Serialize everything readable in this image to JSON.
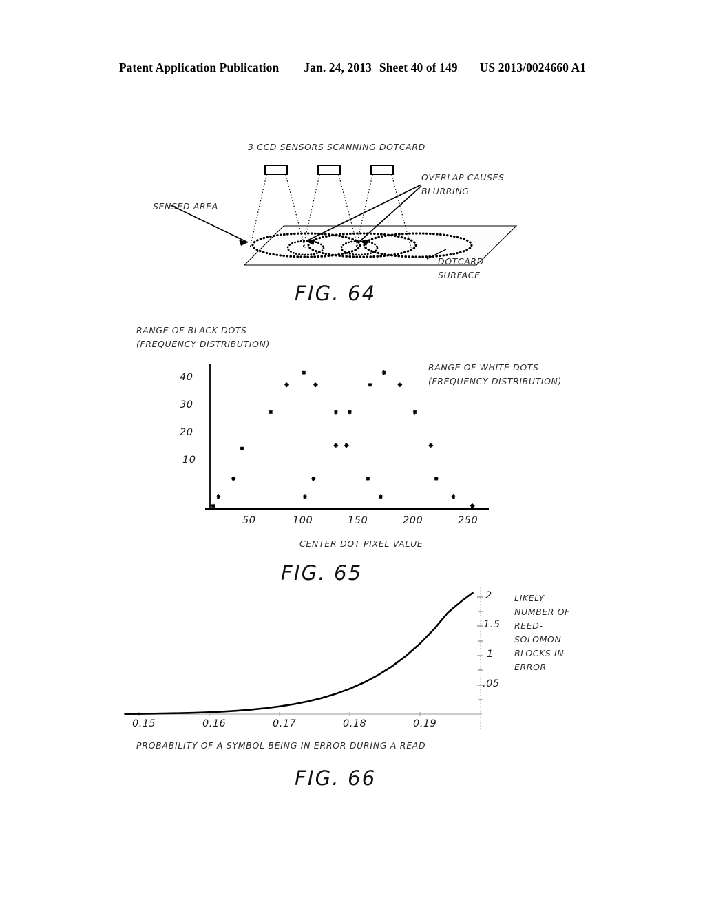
{
  "header": {
    "publication": "Patent Application Publication",
    "date": "Jan. 24, 2013",
    "sheet": "Sheet 40 of 149",
    "publication_number": "US 2013/0024660 A1"
  },
  "figures": [
    {
      "id": "fig64",
      "caption": "FIG. 64",
      "labels": {
        "top": "3 CCD SENSORS SCANNING DOTCARD",
        "right_upper_line1": "OVERLAP CAUSES",
        "right_upper_line2": "BLURRING",
        "left": "SENSED AREA",
        "right_lower_line1": "DOTCARD",
        "right_lower_line2": "SURFACE"
      }
    },
    {
      "id": "fig65",
      "caption": "FIG. 65",
      "labels": {
        "y_axis_line1": "RANGE OF BLACK DOTS",
        "y_axis_line2": "(FREQUENCY DISTRIBUTION)",
        "note_line1": "RANGE OF WHITE DOTS",
        "note_line2": "(FREQUENCY DISTRIBUTION)",
        "x_axis_title": "CENTER DOT PIXEL VALUE"
      }
    },
    {
      "id": "fig66",
      "caption": "FIG. 66",
      "labels": {
        "note_line1": "LIKELY",
        "note_line2": "NUMBER OF",
        "note_line3": "REED-",
        "note_line4": "SOLOMON",
        "note_line5": "BLOCKS IN",
        "note_line6": "ERROR",
        "x_axis_title": "PROBABILITY OF A SYMBOL BEING IN ERROR DURING A READ"
      }
    }
  ],
  "chart_data": [
    {
      "type": "scatter",
      "figure": "FIG. 65",
      "title": "",
      "ylabel": "RANGE OF BLACK DOTS (FREQUENCY DISTRIBUTION)",
      "xlabel": "CENTER DOT PIXEL VALUE",
      "annotation": "RANGE OF WHITE DOTS (FREQUENCY DISTRIBUTION)",
      "xlim": [
        0,
        260
      ],
      "ylim": [
        0,
        48
      ],
      "xticks": [
        50,
        100,
        150,
        200,
        250
      ],
      "yticks": [
        10,
        20,
        30,
        40
      ],
      "grid": false,
      "legend": "none",
      "points": [
        {
          "x": 3,
          "y": 1
        },
        {
          "x": 8,
          "y": 4
        },
        {
          "x": 22,
          "y": 10
        },
        {
          "x": 30,
          "y": 20
        },
        {
          "x": 57,
          "y": 32
        },
        {
          "x": 72,
          "y": 41
        },
        {
          "x": 88,
          "y": 45
        },
        {
          "x": 89,
          "y": 4
        },
        {
          "x": 97,
          "y": 10
        },
        {
          "x": 99,
          "y": 41
        },
        {
          "x": 118,
          "y": 21
        },
        {
          "x": 118,
          "y": 32
        },
        {
          "x": 128,
          "y": 21
        },
        {
          "x": 131,
          "y": 32
        },
        {
          "x": 148,
          "y": 10
        },
        {
          "x": 150,
          "y": 41
        },
        {
          "x": 160,
          "y": 4
        },
        {
          "x": 163,
          "y": 45
        },
        {
          "x": 178,
          "y": 41
        },
        {
          "x": 192,
          "y": 32
        },
        {
          "x": 207,
          "y": 21
        },
        {
          "x": 212,
          "y": 10
        },
        {
          "x": 228,
          "y": 4
        },
        {
          "x": 246,
          "y": 1
        }
      ]
    },
    {
      "type": "line",
      "figure": "FIG. 66",
      "title": "",
      "ylabel": "LIKELY NUMBER OF REED-SOLOMON BLOCKS IN ERROR",
      "xlabel": "PROBABILITY OF A SYMBOL BEING IN ERROR DURING A READ",
      "xlim": [
        0.1475,
        0.1985
      ],
      "ylim": [
        0,
        2.25
      ],
      "xticks": [
        0.15,
        0.16,
        0.17,
        0.18,
        0.19
      ],
      "xtick_labels": [
        "0.15",
        "0.16",
        "0.17",
        "0.18",
        "0.19"
      ],
      "yticks": [
        0.5,
        1,
        1.5,
        2
      ],
      "ytick_labels": [
        ".05",
        "1",
        "1.5",
        "2"
      ],
      "grid": false,
      "legend": "none",
      "series": [
        {
          "name": "likely blocks in error",
          "x": [
            0.148,
            0.15,
            0.152,
            0.154,
            0.156,
            0.158,
            0.16,
            0.162,
            0.164,
            0.166,
            0.168,
            0.17,
            0.172,
            0.174,
            0.176,
            0.178,
            0.18,
            0.182,
            0.184,
            0.186,
            0.188,
            0.19,
            0.192,
            0.194,
            0.196,
            0.1975
          ],
          "values": [
            0.004,
            0.006,
            0.009,
            0.013,
            0.018,
            0.025,
            0.034,
            0.046,
            0.062,
            0.082,
            0.108,
            0.14,
            0.18,
            0.23,
            0.292,
            0.368,
            0.46,
            0.572,
            0.706,
            0.866,
            1.056,
            1.28,
            1.542,
            1.846,
            2.06,
            2.2
          ]
        }
      ]
    }
  ]
}
